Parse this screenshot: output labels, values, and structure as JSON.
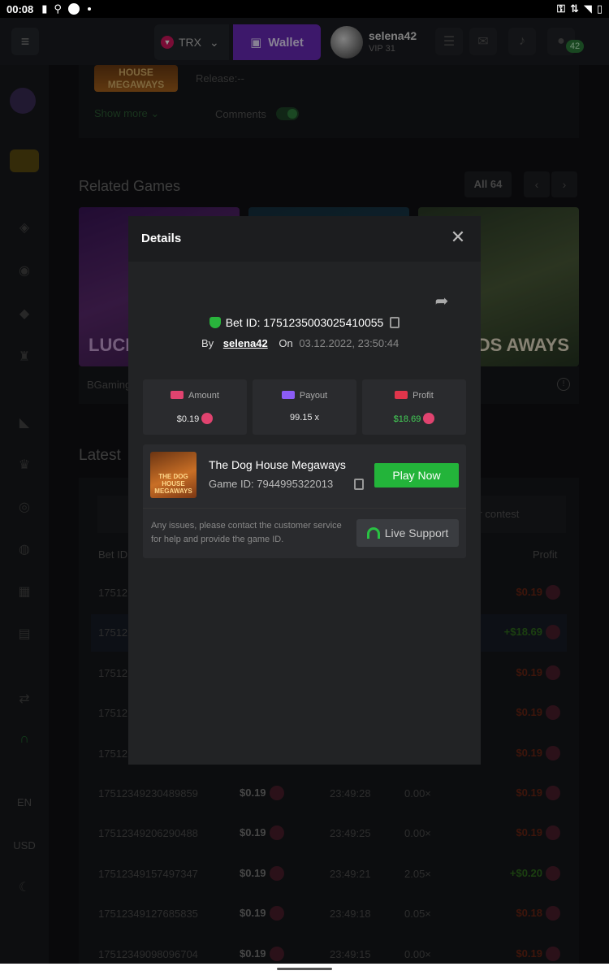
{
  "status_bar": {
    "time": "00:08"
  },
  "header": {
    "currency": "TRX",
    "wallet_label": "Wallet",
    "username": "selena42",
    "vip": "VIP 31",
    "chat_badge": "42"
  },
  "sidebar": {
    "language": "EN",
    "currency": "USD"
  },
  "background": {
    "game_thumb_text": "HOUSE MEGAWAYS",
    "release": "Release:--",
    "show_more": "Show more",
    "comments": "Comments",
    "related_title": "Related Games",
    "all_label": "All 64",
    "tiles": [
      {
        "text": "LUCK MEGA"
      },
      {
        "text": ""
      },
      {
        "text": "WILDS AWAYS"
      }
    ],
    "provider": "BGaming",
    "latest_title": "Latest",
    "contest_tab": "ger contest",
    "col_betid": "Bet ID",
    "col_profit": "Profit",
    "rows": [
      {
        "id": "17512",
        "amount": "",
        "time": "",
        "mult": "",
        "profit": "$0.19",
        "win": false,
        "hl": false
      },
      {
        "id": "17512",
        "amount": "",
        "time": "",
        "mult": "",
        "profit": "+$18.69",
        "win": true,
        "hl": true
      },
      {
        "id": "17512",
        "amount": "",
        "time": "",
        "mult": "",
        "profit": "$0.19",
        "win": false,
        "hl": false
      },
      {
        "id": "17512",
        "amount": "",
        "time": "",
        "mult": "",
        "profit": "$0.19",
        "win": false,
        "hl": false
      },
      {
        "id": "17512",
        "amount": "",
        "time": "",
        "mult": "",
        "profit": "$0.19",
        "win": false,
        "hl": false
      },
      {
        "id": "17512349230489859",
        "amount": "$0.19",
        "time": "23:49:28",
        "mult": "0.00×",
        "profit": "$0.19",
        "win": false,
        "hl": false
      },
      {
        "id": "17512349206290488",
        "amount": "$0.19",
        "time": "23:49:25",
        "mult": "0.00×",
        "profit": "$0.19",
        "win": false,
        "hl": false
      },
      {
        "id": "17512349157497347",
        "amount": "$0.19",
        "time": "23:49:21",
        "mult": "2.05×",
        "profit": "+$0.20",
        "win": true,
        "hl": false
      },
      {
        "id": "17512349127685835",
        "amount": "$0.19",
        "time": "23:49:18",
        "mult": "0.05×",
        "profit": "$0.18",
        "win": false,
        "hl": false
      },
      {
        "id": "17512349098096704",
        "amount": "$0.19",
        "time": "23:49:15",
        "mult": "0.00×",
        "profit": "$0.19",
        "win": false,
        "hl": false
      }
    ]
  },
  "modal": {
    "title": "Details",
    "bet_id": "Bet ID: 1751235003025410055",
    "by_label": "By",
    "by_user": "selena42",
    "on_label": "On",
    "date": "03.12.2022, 23:50:44",
    "stats": [
      {
        "label": "Amount",
        "value": "$0.19",
        "color": "#e8e8e8",
        "icon": "money-icon",
        "icon_color": "#e0436f"
      },
      {
        "label": "Payout",
        "value": "99.15 x",
        "color": "#e8e8e8",
        "icon": "card-icon",
        "icon_color": "#8b5cf6"
      },
      {
        "label": "Profit",
        "value": "$18.69",
        "color": "#43d157",
        "icon": "profit-icon",
        "icon_color": "#e0354b"
      }
    ],
    "game_name": "The Dog House Megaways",
    "game_id": "Game ID: 7944995322013",
    "play_label": "Play Now",
    "note": "Any issues, please contact the customer service for help and provide the game ID.",
    "support_label": "Live Support",
    "thumb_text": "THE DOG HOUSE MEGAWAYS"
  }
}
